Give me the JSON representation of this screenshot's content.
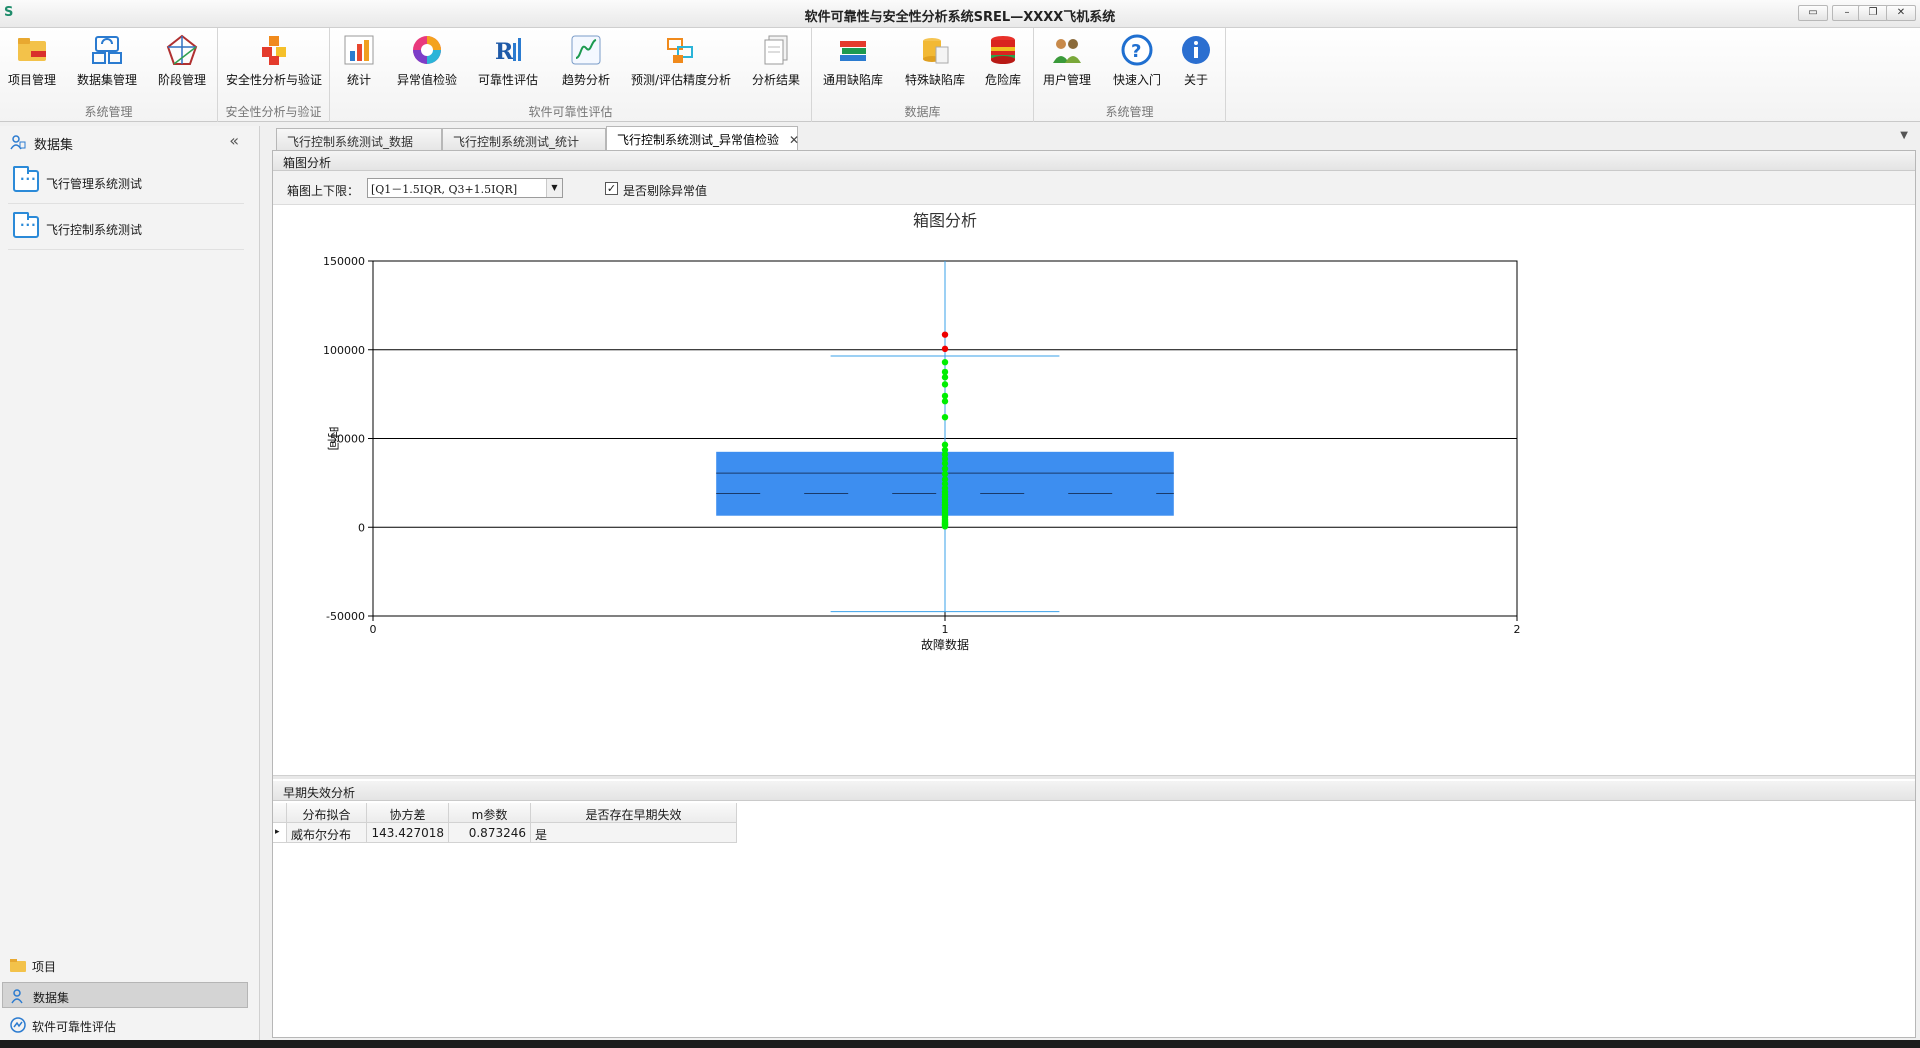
{
  "window": {
    "app_icon": "S",
    "title": "软件可靠性与安全性分析系统SREL—XXXX飞机系统",
    "controls": [
      "restore-icon",
      "minimize-icon",
      "maximize-icon",
      "close-icon"
    ]
  },
  "ribbon": {
    "groups": [
      {
        "label": "系统管理",
        "buttons": [
          {
            "label": "项目管理",
            "icon": "folder-project-icon"
          },
          {
            "label": "数据集管理",
            "icon": "dataset-icon"
          },
          {
            "label": "阶段管理",
            "icon": "stage-icon"
          }
        ]
      },
      {
        "label": "安全性分析与验证",
        "buttons": [
          {
            "label": "安全性分析与验证",
            "icon": "cubes-icon"
          }
        ]
      },
      {
        "label": "软件可靠性评估",
        "buttons": [
          {
            "label": "统计",
            "icon": "bar-chart-icon"
          },
          {
            "label": "异常值检验",
            "icon": "aperture-icon"
          },
          {
            "label": "可靠性评估",
            "icon": "r-chart-icon"
          },
          {
            "label": "趋势分析",
            "icon": "trend-icon"
          },
          {
            "label": "预测/评估精度分析",
            "icon": "precision-icon"
          },
          {
            "label": "分析结果",
            "icon": "document-icon"
          }
        ]
      },
      {
        "label": "数据库",
        "buttons": [
          {
            "label": "通用缺陷库",
            "icon": "books-icon"
          },
          {
            "label": "特殊缺陷库",
            "icon": "database-icon"
          },
          {
            "label": "危险库",
            "icon": "red-database-icon"
          }
        ]
      },
      {
        "label": "系统管理",
        "buttons": [
          {
            "label": "用户管理",
            "icon": "users-icon"
          },
          {
            "label": "快速入门",
            "icon": "help-icon"
          },
          {
            "label": "关于",
            "icon": "info-icon"
          }
        ]
      }
    ]
  },
  "nav": {
    "header": "数据集",
    "collapse": "«",
    "items": [
      "飞行管理系统测试",
      "飞行控制系统测试"
    ],
    "bottom": [
      {
        "label": "项目",
        "selected": false
      },
      {
        "label": "数据集",
        "selected": true
      },
      {
        "label": "软件可靠性评估",
        "selected": false
      }
    ]
  },
  "tabs": [
    {
      "label": "飞行控制系统测试_数据",
      "active": false
    },
    {
      "label": "飞行控制系统测试_统计",
      "active": false
    },
    {
      "label": "飞行控制系统测试_异常值检验",
      "active": true,
      "close": "✕"
    }
  ],
  "tab_menu": "▼",
  "boxplot_panel": {
    "title": "箱图分析",
    "bound_label": "箱图上下限：",
    "bound_value": "[Q1－1.5IQR, Q3+1.5IQR]",
    "outlier_checked": true,
    "check_mark": "✓",
    "outlier_label": "是否剔除异常值"
  },
  "chart_data": {
    "type": "box",
    "title": "箱图分析",
    "xlabel": "故障数据",
    "ylabel": "时间",
    "xlim": [
      0,
      2
    ],
    "ylim": [
      -50000,
      150000
    ],
    "x_ticks": [
      "0",
      "1",
      "2"
    ],
    "y_ticks": [
      "150000",
      "100000",
      "50000",
      "0",
      "-50000"
    ],
    "grid": true,
    "box": {
      "x": 1,
      "q1": 6500,
      "median": 30500,
      "q3": 42500,
      "mean": 19000,
      "upper_whisker": 96500,
      "lower_whisker": -47500
    },
    "colors": {
      "box": "#3d8ef0",
      "inlier": "#00ee00",
      "outlier": "#ee0000",
      "whisker": "#3aa0e8"
    },
    "inliers": [
      500,
      1000,
      1500,
      2000,
      2500,
      3000,
      3500,
      4500,
      5500,
      6500,
      7500,
      8500,
      9500,
      11000,
      12500,
      14000,
      15500,
      17000,
      18500,
      20000,
      22000,
      24500,
      27000,
      30000,
      33000,
      36000,
      38500,
      41000,
      43500,
      46500,
      62000,
      71000,
      74000,
      80500,
      84500,
      87500,
      93000
    ],
    "outliers": [
      100500,
      108500
    ]
  },
  "early_failure": {
    "title": "早期失效分析",
    "columns": [
      "分布拟合",
      "协方差",
      "m参数",
      "是否存在早期失效"
    ],
    "rows": [
      {
        "marker": "▸",
        "cells": [
          "威布尔分布",
          "143.427018",
          "0.873246",
          "是"
        ]
      }
    ]
  }
}
